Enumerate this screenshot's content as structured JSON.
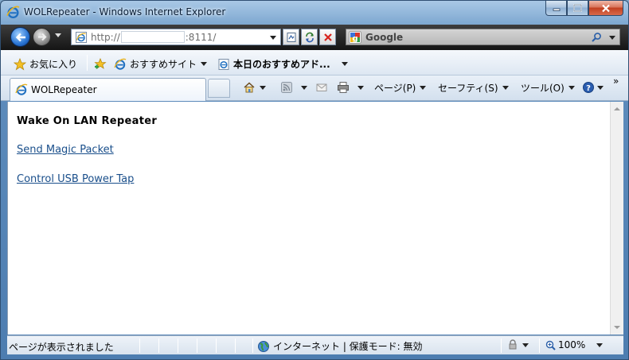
{
  "window": {
    "title": "WOLRepeater - Windows Internet Explorer"
  },
  "address_bar": {
    "url_prefix": "http://",
    "url_suffix": ":8111/"
  },
  "search_box": {
    "provider": "Google"
  },
  "favorites_bar": {
    "favorites_label": "お気に入り",
    "suggested_sites": "おすすめサイト",
    "recommended": "本日のおすすめアド..."
  },
  "tab": {
    "title": "WOLRepeater"
  },
  "command_bar": {
    "page": "ページ(P)",
    "safety": "セーフティ(S)",
    "tools": "ツール(O)",
    "overflow": "»"
  },
  "page": {
    "heading": "Wake On LAN Repeater",
    "links": [
      "Send Magic Packet",
      "Control USB Power Tap"
    ]
  },
  "status_bar": {
    "text": "ページが表示されました",
    "zone": "インターネット | 保護モード: 無効",
    "zoom": "100%"
  },
  "colors": {
    "link": "#1a4f8b",
    "titlebar": "#7da7d0",
    "navbar": "#151515"
  }
}
